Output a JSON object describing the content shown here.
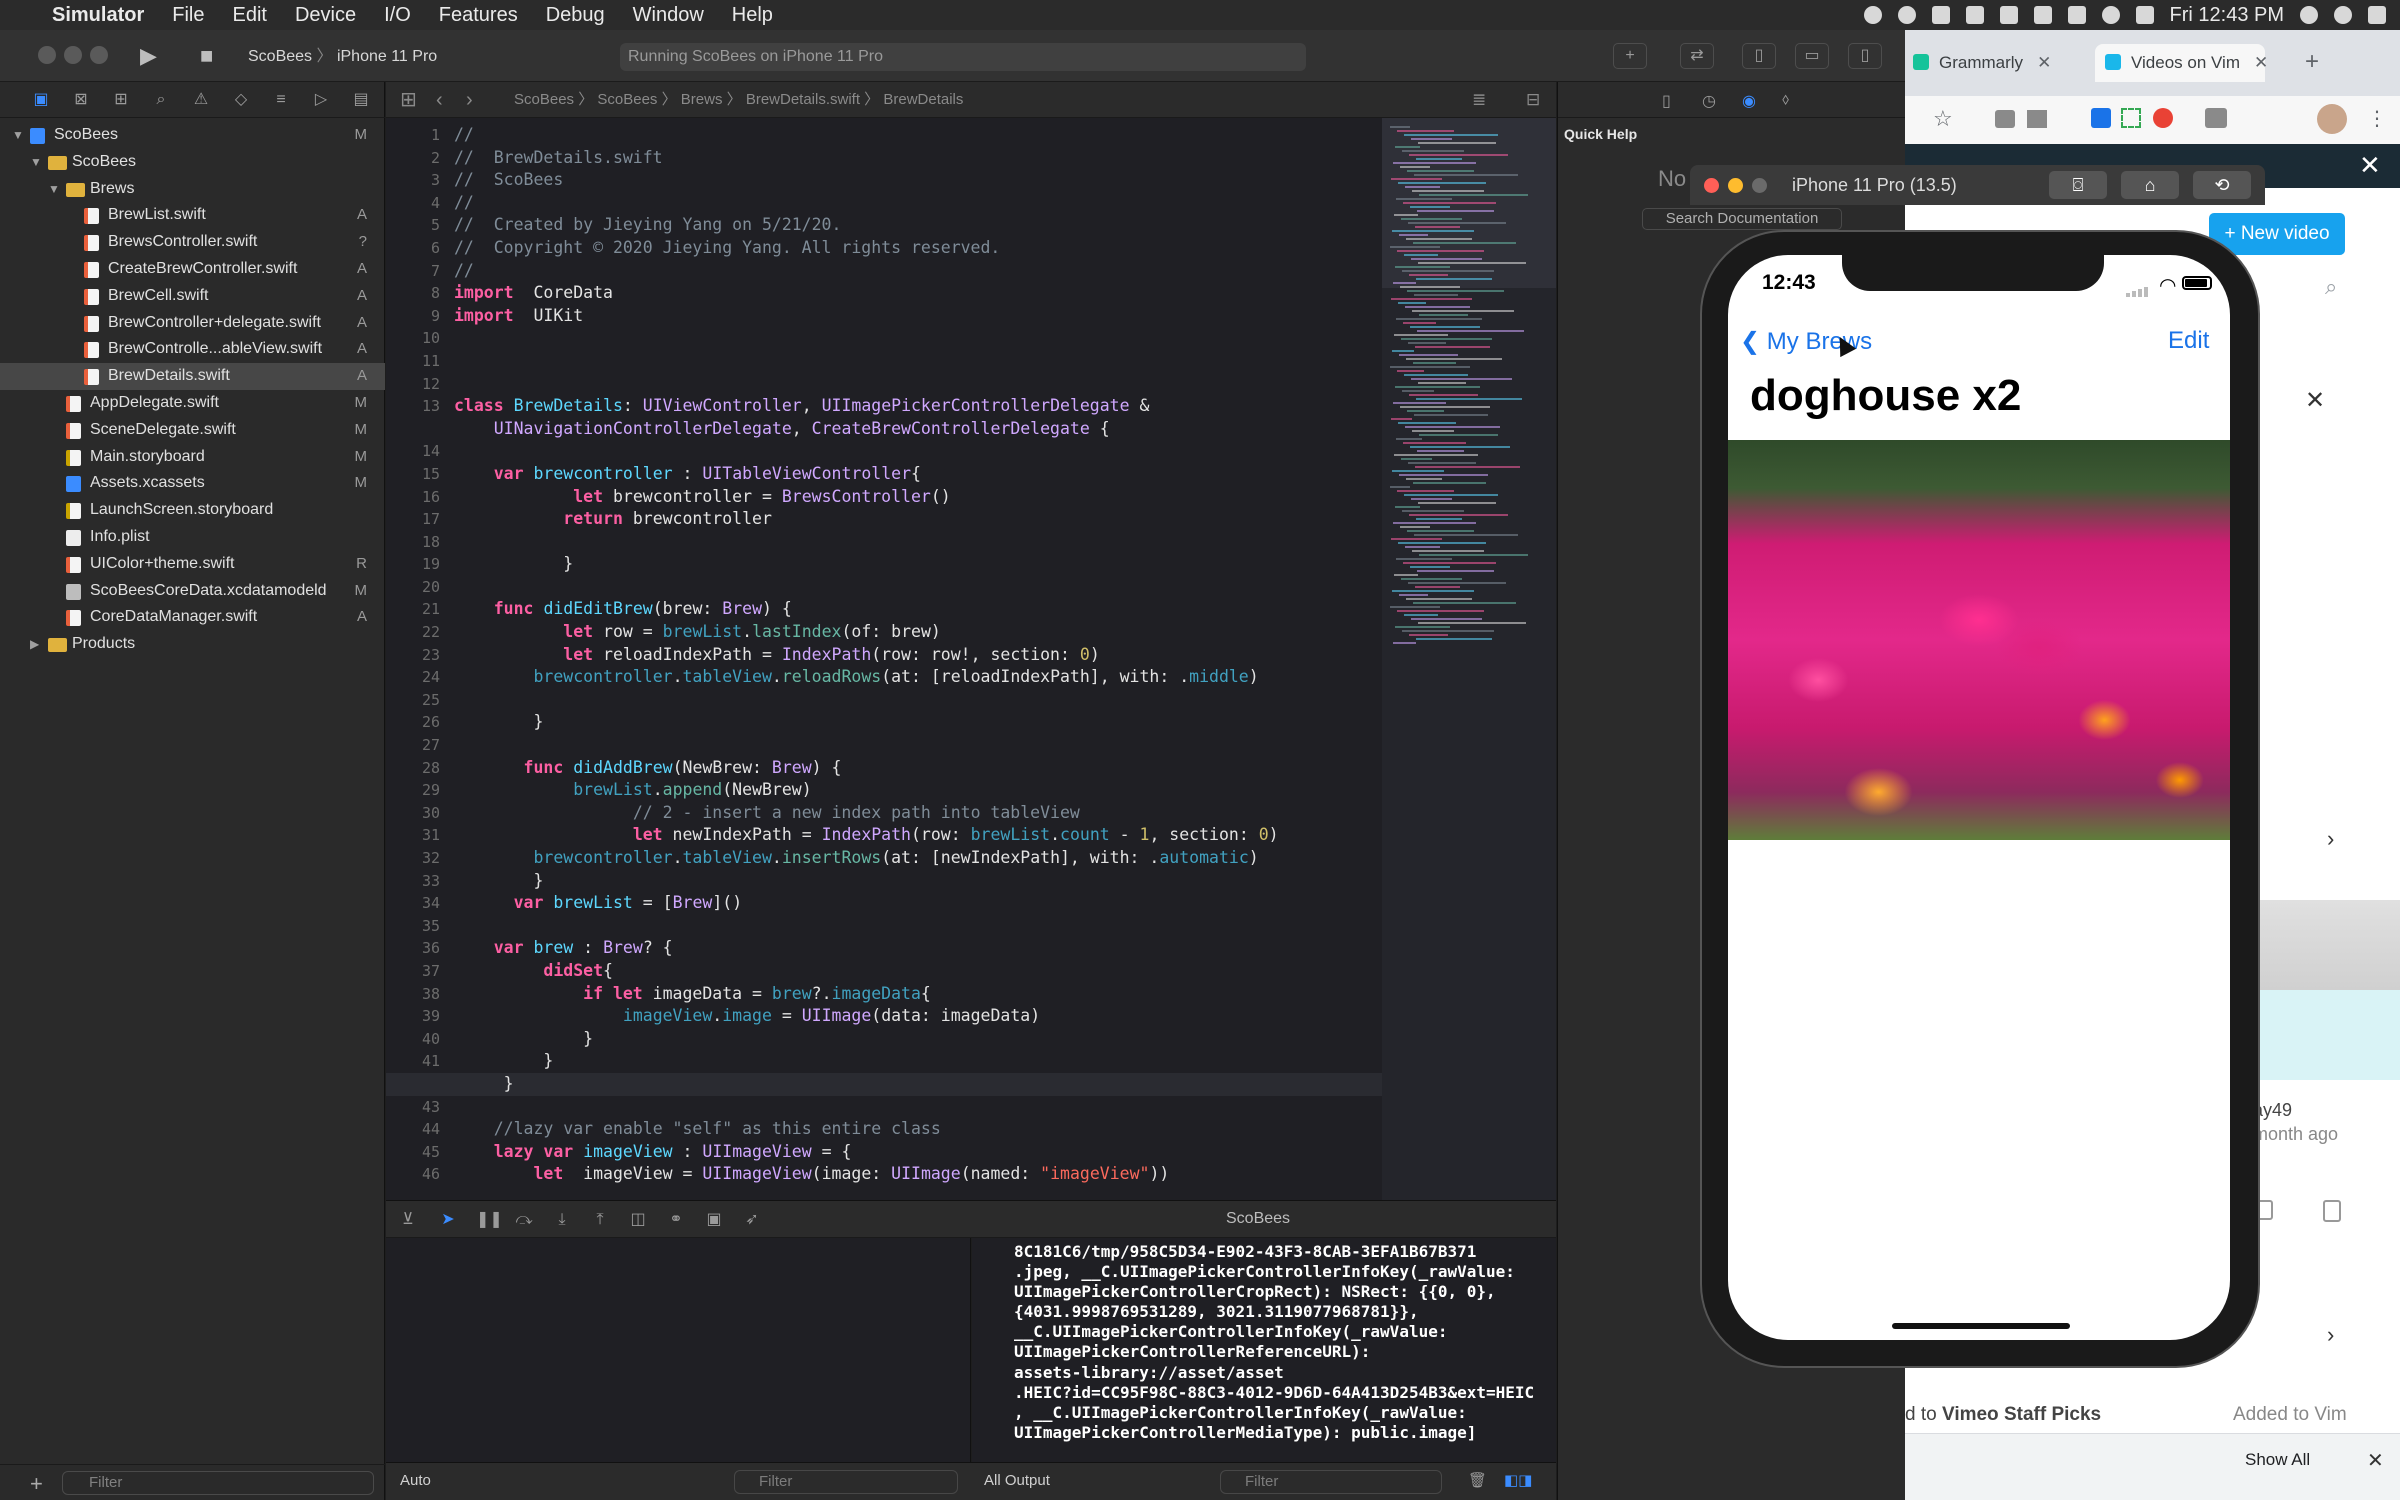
{
  "menubar": {
    "app": "Simulator",
    "items": [
      "File",
      "Edit",
      "Device",
      "I/O",
      "Features",
      "Debug",
      "Window",
      "Help"
    ],
    "clock": "Fri 12:43 PM"
  },
  "xcode": {
    "scheme_project": "ScoBees",
    "scheme_device": "iPhone 11 Pro",
    "activity": "Running ScoBees on iPhone 11 Pro",
    "breadcrumb": [
      "ScoBees",
      "ScoBees",
      "Brews",
      "BrewDetails.swift",
      "BrewDetails"
    ],
    "navigator": [
      {
        "label": "ScoBees",
        "kind": "proj",
        "indent": 0,
        "disc": "open",
        "status": "M"
      },
      {
        "label": "ScoBees",
        "kind": "folder",
        "indent": 1,
        "disc": "open",
        "status": ""
      },
      {
        "label": "Brews",
        "kind": "folder",
        "indent": 2,
        "disc": "open",
        "status": ""
      },
      {
        "label": "BrewList.swift",
        "kind": "swift",
        "indent": 3,
        "status": "A"
      },
      {
        "label": "BrewsController.swift",
        "kind": "swift",
        "indent": 3,
        "status": "?"
      },
      {
        "label": "CreateBrewController.swift",
        "kind": "swift",
        "indent": 3,
        "status": "A"
      },
      {
        "label": "BrewCell.swift",
        "kind": "swift",
        "indent": 3,
        "status": "A"
      },
      {
        "label": "BrewController+delegate.swift",
        "kind": "swift",
        "indent": 3,
        "status": "A"
      },
      {
        "label": "BrewControlle...ableView.swift",
        "kind": "swift",
        "indent": 3,
        "status": "A"
      },
      {
        "label": "BrewDetails.swift",
        "kind": "swift",
        "indent": 3,
        "status": "A",
        "selected": true
      },
      {
        "label": "AppDelegate.swift",
        "kind": "swift",
        "indent": 2,
        "status": "M"
      },
      {
        "label": "SceneDelegate.swift",
        "kind": "swift",
        "indent": 2,
        "status": "M"
      },
      {
        "label": "Main.storyboard",
        "kind": "story",
        "indent": 2,
        "status": "M"
      },
      {
        "label": "Assets.xcassets",
        "kind": "assets",
        "indent": 2,
        "status": "M"
      },
      {
        "label": "LaunchScreen.storyboard",
        "kind": "story",
        "indent": 2,
        "status": ""
      },
      {
        "label": "Info.plist",
        "kind": "plist",
        "indent": 2,
        "status": ""
      },
      {
        "label": "UIColor+theme.swift",
        "kind": "swift",
        "indent": 2,
        "status": "R"
      },
      {
        "label": "ScoBeesCoreData.xcdatamodeld",
        "kind": "data",
        "indent": 2,
        "status": "M"
      },
      {
        "label": "CoreDataManager.swift",
        "kind": "swift",
        "indent": 2,
        "status": "A"
      },
      {
        "label": "Products",
        "kind": "folder",
        "indent": 1,
        "disc": "closed",
        "status": ""
      }
    ],
    "nav_filter": "Filter",
    "line_numbers": [
      "1",
      "2",
      "3",
      "4",
      "5",
      "6",
      "7",
      "8",
      "9",
      "10",
      "11",
      "12",
      "13",
      "",
      "14",
      "15",
      "16",
      "17",
      "18",
      "19",
      "20",
      "21",
      "22",
      "23",
      "24",
      "25",
      "26",
      "27",
      "28",
      "29",
      "30",
      "31",
      "32",
      "33",
      "34",
      "35",
      "36",
      "37",
      "38",
      "39",
      "40",
      "41",
      "42",
      "43",
      "44",
      "45",
      "46"
    ],
    "current_line": "42",
    "code": [
      [
        [
          "c-com",
          "//"
        ]
      ],
      [
        [
          "c-com",
          "//  BrewDetails.swift"
        ]
      ],
      [
        [
          "c-com",
          "//  ScoBees"
        ]
      ],
      [
        [
          "c-com",
          "//"
        ]
      ],
      [
        [
          "c-com",
          "//  Created by Jieying Yang on 5/21/20."
        ]
      ],
      [
        [
          "c-com",
          "//  Copyright © 2020 Jieying Yang. All rights reserved."
        ]
      ],
      [
        [
          "c-com",
          "//"
        ]
      ],
      [
        [
          "c-kw",
          "import"
        ],
        [
          "",
          "  CoreData"
        ]
      ],
      [
        [
          "c-kw",
          "import"
        ],
        [
          "",
          "  UIKit"
        ]
      ],
      [],
      [],
      [],
      [
        [
          "c-kw",
          "class"
        ],
        [
          "",
          " "
        ],
        [
          "c-type",
          "BrewDetails"
        ],
        [
          "",
          ": "
        ],
        [
          "c-ty2",
          "UIViewController"
        ],
        [
          "",
          ", "
        ],
        [
          "c-ty2",
          "UIImagePickerControllerDelegate"
        ],
        [
          "",
          " &"
        ]
      ],
      [
        [
          "",
          "    "
        ],
        [
          "c-ty2",
          "UINavigationControllerDelegate"
        ],
        [
          "",
          ", "
        ],
        [
          "c-ty2",
          "CreateBrewControllerDelegate"
        ],
        [
          "",
          " {"
        ]
      ],
      [],
      [
        [
          "",
          "    "
        ],
        [
          "c-kw",
          "var"
        ],
        [
          "",
          " "
        ],
        [
          "c-type",
          "brewcontroller"
        ],
        [
          "",
          " : "
        ],
        [
          "c-ty2",
          "UITableViewController"
        ],
        [
          "",
          "{"
        ]
      ],
      [
        [
          "",
          "            "
        ],
        [
          "c-kw",
          "let"
        ],
        [
          "",
          " brewcontroller = "
        ],
        [
          "c-ty2",
          "BrewsController"
        ],
        [
          "",
          "()"
        ]
      ],
      [
        [
          "",
          "           "
        ],
        [
          "c-kw",
          "return"
        ],
        [
          "",
          " brewcontroller"
        ]
      ],
      [],
      [
        [
          "",
          "           }"
        ]
      ],
      [],
      [
        [
          "",
          "    "
        ],
        [
          "c-kw",
          "func"
        ],
        [
          "",
          " "
        ],
        [
          "c-type",
          "didEditBrew"
        ],
        [
          "",
          "(brew: "
        ],
        [
          "c-ty2",
          "Brew"
        ],
        [
          "",
          ") {"
        ]
      ],
      [
        [
          "",
          "           "
        ],
        [
          "c-kw",
          "let"
        ],
        [
          "",
          " row = "
        ],
        [
          "c-prop",
          "brewList"
        ],
        [
          "",
          "."
        ],
        [
          "c-fn",
          "lastIndex"
        ],
        [
          "",
          "(of: brew)"
        ]
      ],
      [
        [
          "",
          "           "
        ],
        [
          "c-kw",
          "let"
        ],
        [
          "",
          " reloadIndexPath = "
        ],
        [
          "c-ty2",
          "IndexPath"
        ],
        [
          "",
          "(row: row!, section: "
        ],
        [
          "c-num",
          "0"
        ],
        [
          "",
          ")"
        ]
      ],
      [
        [
          "",
          "        "
        ],
        [
          "c-prop",
          "brewcontroller"
        ],
        [
          "",
          "."
        ],
        [
          "c-prop",
          "tableView"
        ],
        [
          "",
          "."
        ],
        [
          "c-fn",
          "reloadRows"
        ],
        [
          "",
          "(at: [reloadIndexPath], with: ."
        ],
        [
          "c-prop",
          "middle"
        ],
        [
          "",
          ")"
        ]
      ],
      [],
      [
        [
          "",
          "        }"
        ]
      ],
      [],
      [
        [
          "",
          "       "
        ],
        [
          "c-kw",
          "func"
        ],
        [
          "",
          " "
        ],
        [
          "c-type",
          "didAddBrew"
        ],
        [
          "",
          "(NewBrew: "
        ],
        [
          "c-ty2",
          "Brew"
        ],
        [
          "",
          ") {"
        ]
      ],
      [
        [
          "",
          "            "
        ],
        [
          "c-prop",
          "brewList"
        ],
        [
          "",
          "."
        ],
        [
          "c-fn",
          "append"
        ],
        [
          "",
          "(NewBrew)"
        ]
      ],
      [
        [
          "",
          "                  "
        ],
        [
          "c-com",
          "// 2 - insert a new index path into tableView"
        ]
      ],
      [
        [
          "",
          "                  "
        ],
        [
          "c-kw",
          "let"
        ],
        [
          "",
          " newIndexPath = "
        ],
        [
          "c-ty2",
          "IndexPath"
        ],
        [
          "",
          "(row: "
        ],
        [
          "c-prop",
          "brewList"
        ],
        [
          "",
          "."
        ],
        [
          "c-prop",
          "count"
        ],
        [
          "",
          " - "
        ],
        [
          "c-num",
          "1"
        ],
        [
          "",
          ", section: "
        ],
        [
          "c-num",
          "0"
        ],
        [
          "",
          ")"
        ]
      ],
      [
        [
          "",
          "        "
        ],
        [
          "c-prop",
          "brewcontroller"
        ],
        [
          "",
          "."
        ],
        [
          "c-prop",
          "tableView"
        ],
        [
          "",
          "."
        ],
        [
          "c-fn",
          "insertRows"
        ],
        [
          "",
          "(at: [newIndexPath], with: ."
        ],
        [
          "c-prop",
          "automatic"
        ],
        [
          "",
          ")"
        ]
      ],
      [
        [
          "",
          "        }"
        ]
      ],
      [
        [
          "",
          "      "
        ],
        [
          "c-kw",
          "var"
        ],
        [
          "",
          " "
        ],
        [
          "c-type",
          "brewList"
        ],
        [
          "",
          " = ["
        ],
        [
          "c-ty2",
          "Brew"
        ],
        [
          "",
          "]()"
        ]
      ],
      [],
      [
        [
          "",
          "    "
        ],
        [
          "c-kw",
          "var"
        ],
        [
          "",
          " "
        ],
        [
          "c-type",
          "brew"
        ],
        [
          "",
          " : "
        ],
        [
          "c-ty2",
          "Brew"
        ],
        [
          "",
          "? {"
        ]
      ],
      [
        [
          "",
          "         "
        ],
        [
          "c-kw",
          "didSet"
        ],
        [
          "",
          "{"
        ]
      ],
      [
        [
          "",
          "             "
        ],
        [
          "c-kw",
          "if let"
        ],
        [
          "",
          " imageData = "
        ],
        [
          "c-prop",
          "brew"
        ],
        [
          "",
          "?."
        ],
        [
          "c-prop",
          "imageData"
        ],
        [
          "",
          "{"
        ]
      ],
      [
        [
          "",
          "                 "
        ],
        [
          "c-prop",
          "imageView"
        ],
        [
          "",
          "."
        ],
        [
          "c-prop",
          "image"
        ],
        [
          "",
          " = "
        ],
        [
          "c-ty2",
          "UIImage"
        ],
        [
          "",
          "(data: imageData)"
        ]
      ],
      [
        [
          "",
          "             }"
        ]
      ],
      [
        [
          "",
          "         }"
        ]
      ],
      [
        [
          "",
          "     }"
        ]
      ],
      [],
      [
        [
          "",
          "    "
        ],
        [
          "c-com",
          "//lazy var enable \"self\" as this entire class"
        ]
      ],
      [
        [
          "",
          "    "
        ],
        [
          "c-kw",
          "lazy var"
        ],
        [
          "",
          " "
        ],
        [
          "c-type",
          "imageView"
        ],
        [
          "",
          " : "
        ],
        [
          "c-ty2",
          "UIImageView"
        ],
        [
          "",
          " = {"
        ]
      ],
      [
        [
          "",
          "        "
        ],
        [
          "c-kw",
          "let"
        ],
        [
          "",
          "  imageView = "
        ],
        [
          "c-ty2",
          "UIImageView"
        ],
        [
          "",
          "(image: "
        ],
        [
          "c-ty2",
          "UIImage"
        ],
        [
          "",
          "(named: "
        ],
        [
          "c-str",
          "\"imageView\""
        ],
        [
          "",
          "))"
        ]
      ]
    ],
    "debug_process": "ScoBees",
    "console": "8C181C6/tmp/958C5D34-E902-43F3-8CAB-3EFA1B67B371\n.jpeg, __C.UIImagePickerControllerInfoKey(_rawValue:\nUIImagePickerControllerCropRect): NSRect: {{0, 0},\n{4031.9998769531289, 3021.3119077968781}},\n__C.UIImagePickerControllerInfoKey(_rawValue:\nUIImagePickerControllerReferenceURL):\nassets-library://asset/asset\n.HEIC?id=CC95F98C-88C3-4012-9D6D-64A413D254B3&ext=HEIC\n, __C.UIImagePickerControllerInfoKey(_rawValue:\nUIImagePickerControllerMediaType): public.image]",
    "var_scope": "Auto",
    "var_filter": "Filter",
    "output_scope": "All Output",
    "console_filter": "Filter",
    "quick_help_title": "Quick Help",
    "quick_help_empty": "No",
    "search_docs": "Search Documentation"
  },
  "browser": {
    "tabs": [
      {
        "label": "Grammarly",
        "favicon_color": "#15c39a"
      },
      {
        "label": "Videos on Vim",
        "favicon_color": "#1ab7ea"
      }
    ],
    "new_video": "New video",
    "card_meta_1": "ay49",
    "card_meta_2": "month ago",
    "caption_1": "d to ",
    "caption_1_strong": "Vimeo Staff Picks",
    "caption_2": "Added to Vim",
    "show_all": "Show All"
  },
  "simulator": {
    "window_title": "iPhone 11 Pro (13.5)",
    "status_time": "12:43",
    "back_label": "My Brews",
    "edit_label": "Edit",
    "title": "doghouse x2"
  }
}
